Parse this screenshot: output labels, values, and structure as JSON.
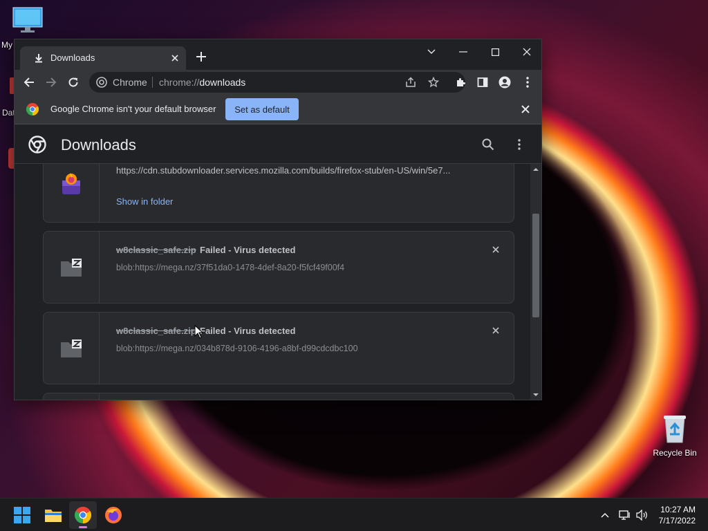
{
  "desktop": {
    "icons": [
      {
        "label": "My"
      },
      {
        "label": "Dat"
      },
      {
        "label": "Recycle Bin"
      }
    ]
  },
  "browser": {
    "tab_title": "Downloads",
    "omnibox": {
      "site_label": "Chrome",
      "url_scheme": "chrome://",
      "url_path": "downloads"
    },
    "infobar": {
      "message": "Google Chrome isn't your default browser",
      "button_label": "Set as default"
    }
  },
  "downloads_page": {
    "title": "Downloads",
    "items": [
      {
        "url": "https://cdn.stubdownloader.services.mozilla.com/builds/firefox-stub/en-US/win/5e7...",
        "action_label": "Show in folder"
      },
      {
        "file_name": "w8classic_safe.zip",
        "status": "Failed - Virus detected",
        "url": "blob:https://mega.nz/37f51da0-1478-4def-8a20-f5fcf49f00f4"
      },
      {
        "file_name": "w8classic_safe.zip",
        "status": "Failed - Virus detected",
        "url": "blob:https://mega.nz/034b878d-9106-4196-a8bf-d99cdcdbc100"
      }
    ]
  },
  "taskbar": {
    "apps": [
      "start-icon",
      "file-explorer-icon",
      "chrome-icon",
      "firefox-icon"
    ],
    "time": "10:27 AM",
    "date": "7/17/2022"
  },
  "colors": {
    "accent": "#8ab4f8",
    "surface": "#202124",
    "card": "#292a2d"
  }
}
